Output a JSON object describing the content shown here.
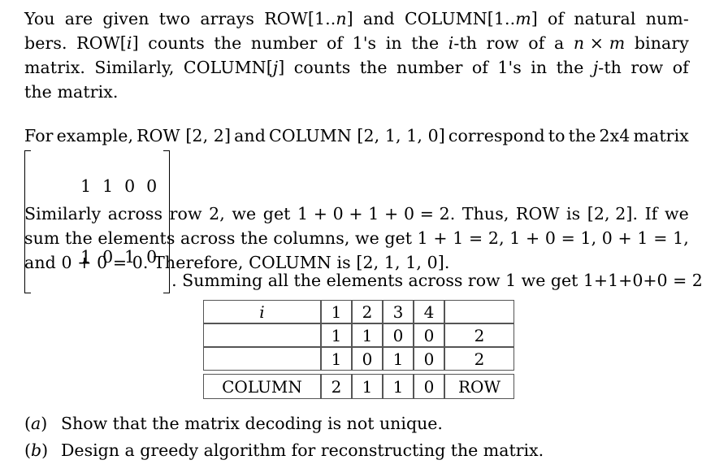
{
  "document": {
    "paragraph1": {
      "lines": [
        [
          "You",
          "are",
          "given",
          "two",
          "arrays",
          "ROW[1..",
          "n",
          "]",
          "and",
          "COLUMN[1..",
          "m",
          "]",
          "of",
          "natural",
          "num-"
        ],
        [
          "bers.",
          "ROW[",
          "i",
          "]",
          "counts",
          "the",
          "number",
          "of",
          "1's",
          "in",
          "the",
          "i",
          "-th",
          "row",
          "of",
          "a",
          "n",
          "×",
          "m",
          "binary"
        ],
        [
          "matrix.",
          "Similarly,",
          "COLUMN[",
          "j",
          "]",
          "counts",
          "the",
          "number",
          "of",
          "1's",
          "in",
          "the",
          "j",
          "-th",
          "row",
          "of"
        ],
        [
          "the matrix."
        ]
      ],
      "line1_segments": [
        {
          "t": "You",
          "i": false
        },
        {
          "t": "are",
          "i": false
        },
        {
          "t": "given",
          "i": false
        },
        {
          "t": "two",
          "i": false
        },
        {
          "t": "arrays",
          "i": false
        },
        {
          "t": "ROW[1..n] ",
          "i": false
        },
        {
          "t": "and",
          "i": false
        },
        {
          "t": "COLUMN[1..m] ",
          "i": false
        },
        {
          "t": "of",
          "i": false
        },
        {
          "t": "natural",
          "i": false
        },
        {
          "t": "num-",
          "i": false
        }
      ],
      "line1_plain": "You are given two arrays ROW[1..n] and COLUMN[1..m] of natural num-",
      "line2_plain": "bers.  ROW[i] counts the number of 1's in the i-th row of a n × m binary",
      "line3_plain": "matrix.  Similarly, COLUMN[j] counts the number of 1's in the j-th row of",
      "line4_plain": "the matrix."
    },
    "paragraph2": {
      "line1_plain": "For example, ROW [2, 2] and COLUMN [2, 1, 1, 0] correspond to the 2x4 matrix",
      "matrix": {
        "rows": [
          [
            "1",
            "1",
            "0",
            "0"
          ],
          [
            "1",
            "0",
            "1",
            "0"
          ]
        ]
      },
      "matrix_tail": ". Summing all the elements across row 1 we get 1+1+0+0 = 2.",
      "line3_plain": "Similarly across row 2, we get 1 + 0 + 1 + 0 = 2.  Thus, ROW is [2, 2].  If we",
      "line4_plain": "sum the elements across the columns, we get 1 + 1 = 2, 1 + 0 = 1, 0 + 1 = 1,",
      "line5_plain": "and 0 + 0 = 0.  Therefore, COLUMN is [2, 1, 1, 0]."
    },
    "table": {
      "header": {
        "label": "i",
        "indices": [
          "1",
          "2",
          "3",
          "4"
        ],
        "corner": ""
      },
      "rows": [
        {
          "label": "",
          "values": [
            "1",
            "1",
            "0",
            "0"
          ],
          "sum": "2"
        },
        {
          "label": "",
          "values": [
            "1",
            "0",
            "1",
            "0"
          ],
          "sum": "2"
        }
      ],
      "footer": {
        "label": "COLUMN",
        "values": [
          "2",
          "1",
          "1",
          "0"
        ],
        "sum": "ROW"
      }
    },
    "items": [
      {
        "mark_open": "(",
        "mark_letter": "a",
        "mark_close": ")",
        "text": "Show that the matrix decoding is not unique."
      },
      {
        "mark_open": "(",
        "mark_letter": "b",
        "mark_close": ")",
        "text": "Design a greedy algorithm for reconstructing the matrix."
      }
    ]
  },
  "colors": {
    "background": "#ffffff",
    "text": "#000000",
    "rule": "#555555"
  }
}
